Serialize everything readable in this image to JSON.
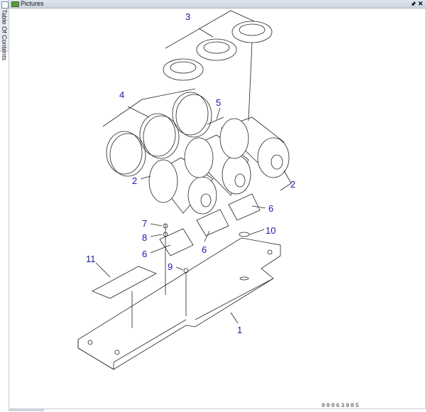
{
  "left_tab": {
    "label": "Table Of Contents",
    "icon": "document-icon"
  },
  "panel": {
    "title": "Pictures",
    "icon": "picture-icon",
    "pin_icon": "pin-icon",
    "close_icon": "close-icon"
  },
  "diagram": {
    "callouts": [
      "3",
      "4",
      "5",
      "2",
      "2",
      "6",
      "7",
      "8",
      "10",
      "6",
      "6",
      "11",
      "9",
      "1"
    ],
    "drawing_number": "00063985"
  }
}
